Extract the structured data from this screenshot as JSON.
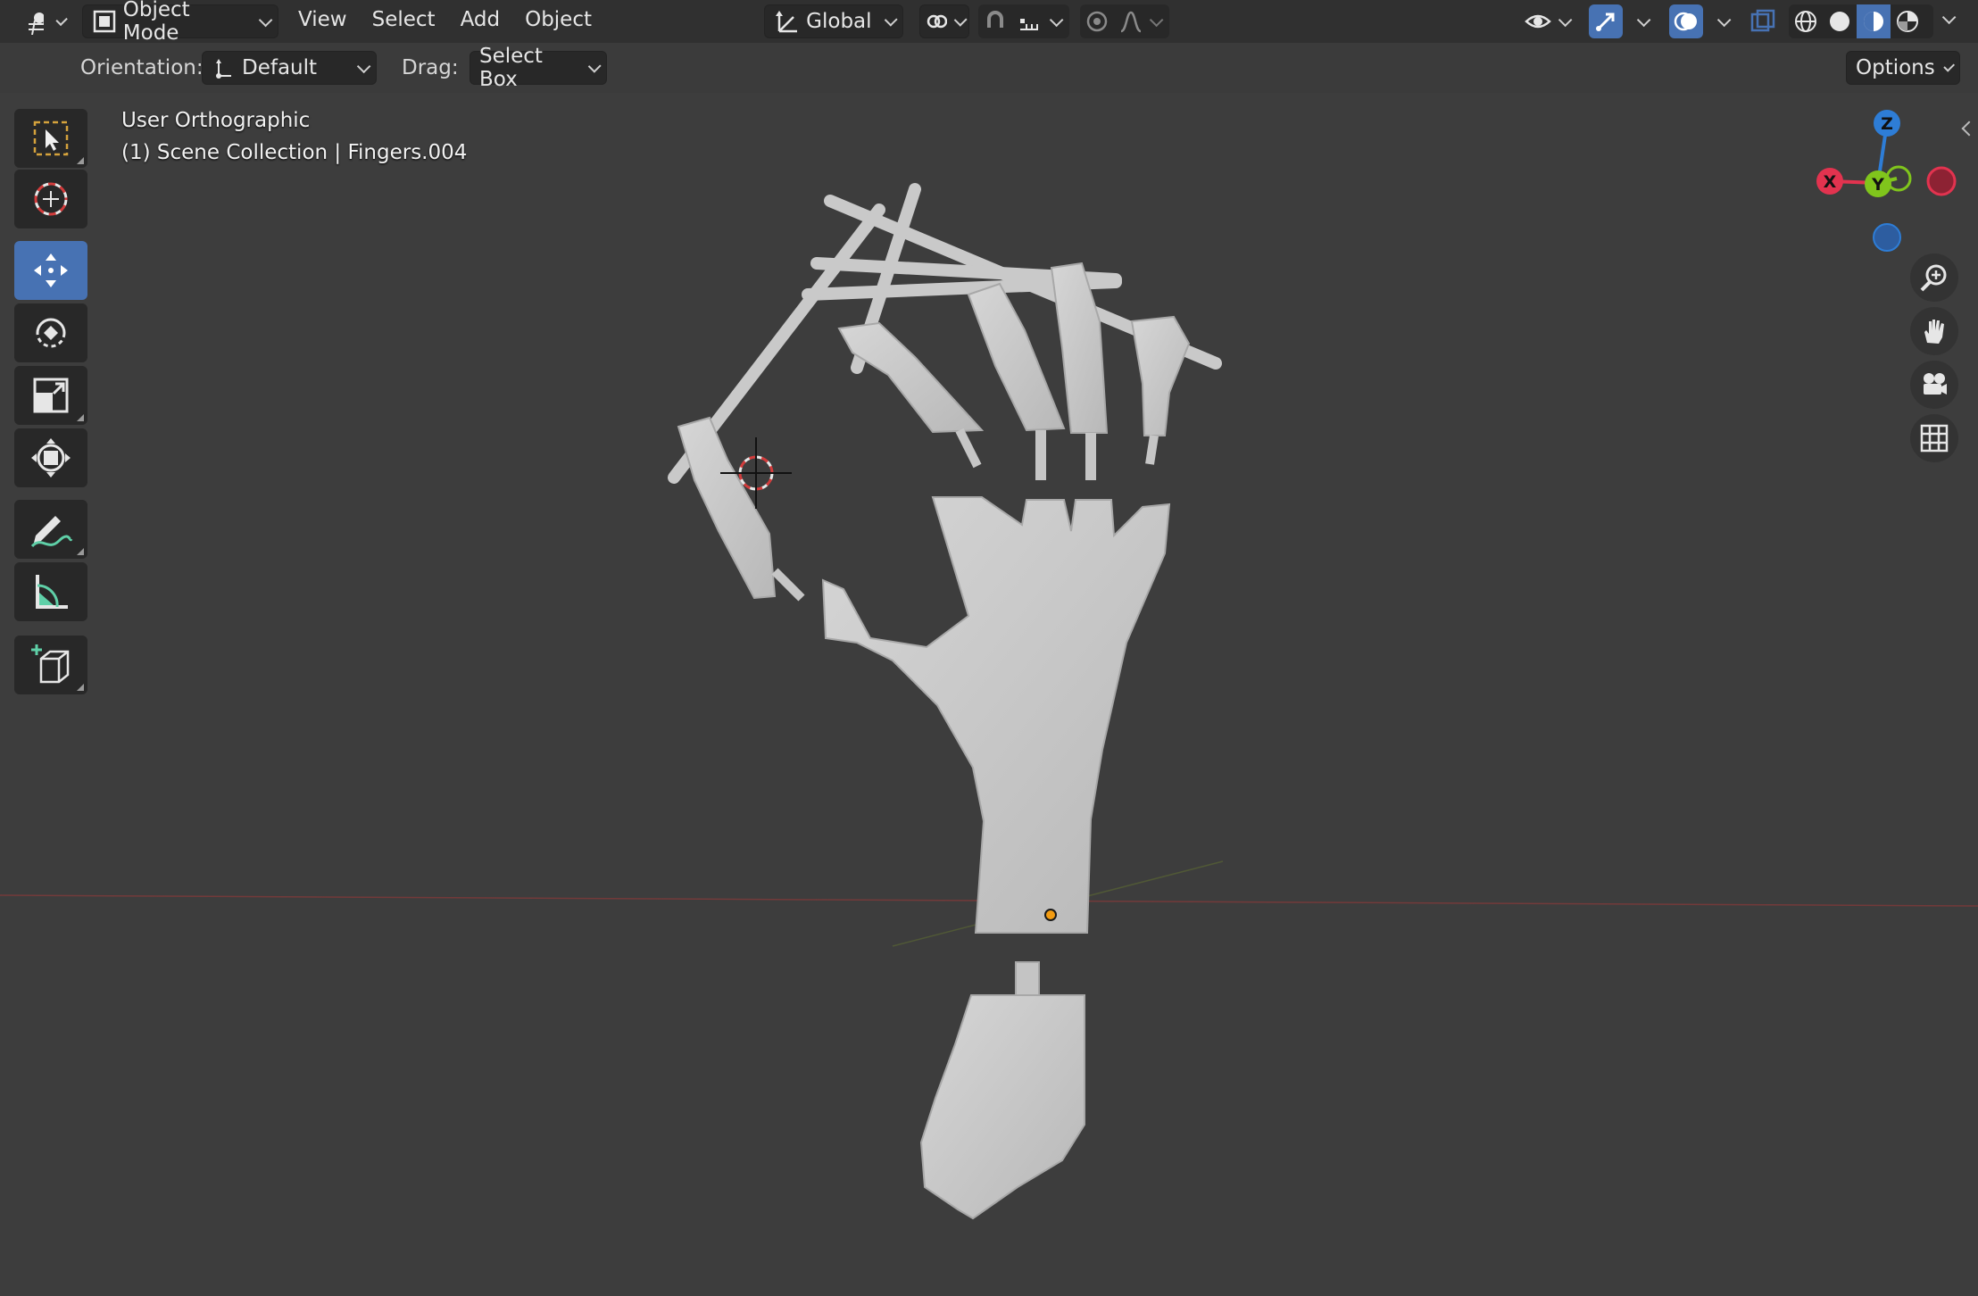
{
  "header": {
    "editor_type_icon": "3d-viewport-icon",
    "mode": {
      "label": "Object Mode",
      "icon": "object-mode-icon"
    },
    "menus": [
      "View",
      "Select",
      "Add",
      "Object"
    ],
    "transform_orientation": {
      "label": "Global",
      "icon": "orientation-axes-icon"
    },
    "pivot_icon": "pivot-point-icon",
    "snap_icons": [
      "snap-magnet-icon",
      "snap-increment-icon"
    ],
    "proportional_icons": [
      "proportional-edit-icon",
      "falloff-curve-icon"
    ],
    "right_icons": [
      "visibility-eye-icon",
      "gizmo-icon",
      "overlay-icon",
      "xray-icon"
    ],
    "shading_modes": [
      "wireframe",
      "solid",
      "material-preview",
      "rendered"
    ],
    "active_shading": "material-preview"
  },
  "tool_settings": {
    "orientation_label": "Orientation:",
    "orientation_value": "Default",
    "drag_label": "Drag:",
    "drag_value": "Select Box",
    "options_label": "Options"
  },
  "viewport": {
    "view_name": "User Orthographic",
    "collection_info": "(1) Scene Collection | Fingers.004"
  },
  "toolbar": {
    "tools": [
      "select-box-tool",
      "cursor-tool",
      "move-tool",
      "rotate-tool",
      "scale-tool",
      "transform-tool",
      "annotate-tool",
      "measure-tool",
      "add-cube-tool"
    ],
    "active_tool": "move-tool"
  },
  "gizmo": {
    "axes": [
      "X",
      "Y",
      "Z"
    ],
    "colors": {
      "x": "#e2334f",
      "y": "#80c51c",
      "z": "#2e7dd6"
    }
  },
  "navigation": [
    "zoom-icon",
    "pan-hand-icon",
    "camera-icon",
    "perspective-grid-icon"
  ],
  "colors": {
    "accent": "#4772b3",
    "background": "#3d3d3d",
    "header": "#303030",
    "model": "#cfcfcf"
  }
}
